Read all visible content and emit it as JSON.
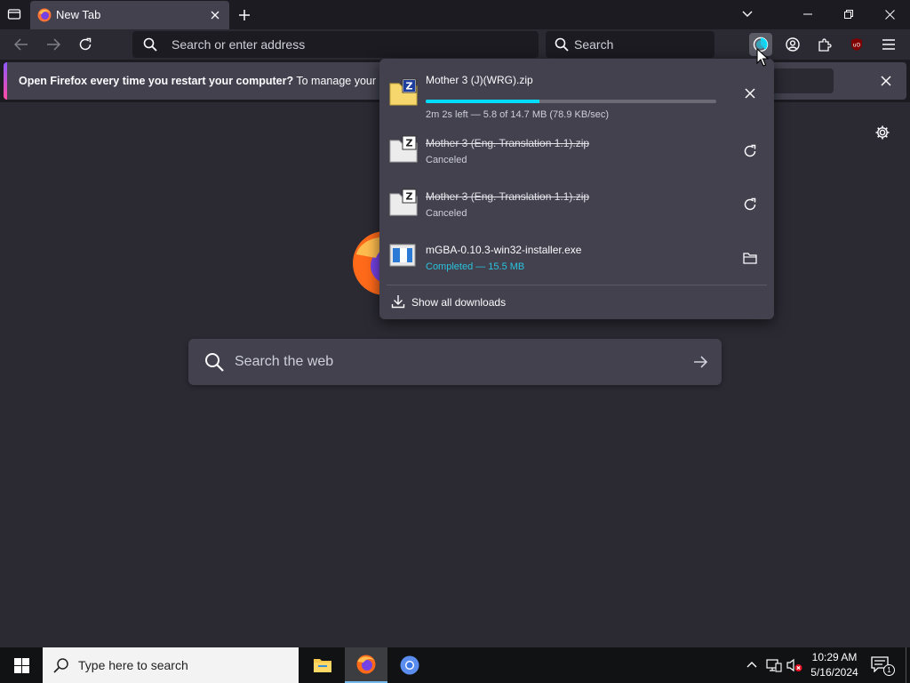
{
  "tab": {
    "title": "New Tab",
    "favicon": "firefox-icon"
  },
  "toolbar": {
    "url_placeholder": "Search or enter address",
    "search_placeholder": "Search"
  },
  "notification": {
    "bold": "Open Firefox every time you restart your computer?",
    "text": " To manage your Start"
  },
  "new_tab_page": {
    "search_placeholder": "Search the web"
  },
  "downloads": {
    "items": [
      {
        "name": "Mother 3 (J)(WRG).zip",
        "status": "2m 2s left — 5.8 of 14.7 MB (78.9 KB/sec)",
        "progress": 0.39,
        "state": "in-progress",
        "action_icon": "cancel-icon"
      },
      {
        "name": "Mother 3 (Eng. Translation 1.1).zip",
        "status": "Canceled",
        "state": "canceled",
        "action_icon": "retry-icon"
      },
      {
        "name": "Mother 3 (Eng. Translation 1.1).zip",
        "status": "Canceled",
        "state": "canceled",
        "action_icon": "retry-icon"
      },
      {
        "name": "mGBA-0.10.3-win32-installer.exe",
        "status": "Completed — 15.5 MB",
        "state": "completed",
        "action_icon": "folder-icon"
      }
    ],
    "show_all": "Show all downloads"
  },
  "taskbar": {
    "search_text": "Type here to search",
    "time": "10:29 AM",
    "date": "5/16/2024",
    "notification_count": "1"
  },
  "colors": {
    "accent": "#00ddff",
    "completed": "#2ac3de",
    "panel_bg": "#42414d",
    "toolbar_bg": "#2b2a33"
  }
}
